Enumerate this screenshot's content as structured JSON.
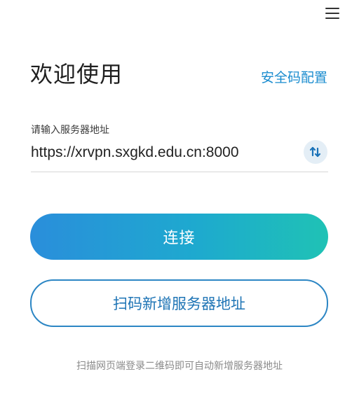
{
  "header": {
    "menu_icon": "hamburger-menu-icon",
    "welcome_title": "欢迎使用",
    "security_code_link": "安全码配置"
  },
  "server_field": {
    "label": "请输入服务器地址",
    "value": "https://xrvpn.sxgkd.edu.cn:8000",
    "swap_icon": "swap-arrows-icon"
  },
  "buttons": {
    "connect_label": "连接",
    "scan_label": "扫码新增服务器地址"
  },
  "footer": {
    "hint": "扫描网页端登录二维码即可自动新增服务器地址"
  },
  "colors": {
    "accent": "#1a8ccf",
    "gradient_start": "#2a8edb",
    "gradient_end": "#1fc2b5",
    "outline": "#2c86c4"
  }
}
